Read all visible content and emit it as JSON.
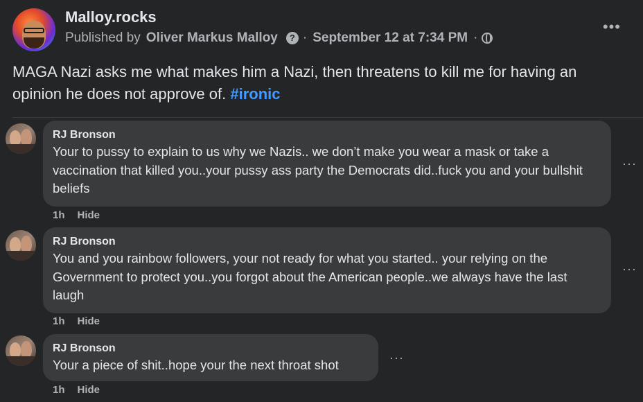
{
  "post": {
    "page_name": "Malloy.rocks",
    "published_by_prefix": "Published by",
    "author": "Oliver Markus Malloy",
    "date": "September 12 at 7:34 PM",
    "separator": "·",
    "text": "MAGA Nazi asks me what makes him a Nazi, then threatens to kill me for having an opinion he does not approve of.",
    "hashtag": "#ironic",
    "menu_icon": "more-horizontal-icon",
    "privacy_icon": "globe-icon"
  },
  "comments": [
    {
      "author": "RJ Bronson",
      "text": "Your to pussy to explain to us why we Nazis.. we don’t make you wear a mask or take a vaccination that killed you..your pussy ass party the Democrats did..fuck you and your bullshit beliefs",
      "time": "1h",
      "action": "Hide"
    },
    {
      "author": "RJ Bronson",
      "text": "You and you rainbow followers, your not ready for what you started.. your relying on the Government to protect you..you forgot about the American people..we always have the last laugh",
      "time": "1h",
      "action": "Hide"
    },
    {
      "author": "RJ Bronson",
      "text": "Your a piece of shit..hope your the next throat shot",
      "time": "1h",
      "action": "Hide"
    }
  ],
  "colors": {
    "background": "#242526",
    "bubble": "#3a3b3c",
    "text": "#e4e6eb",
    "secondary": "#b0b3b8",
    "hashtag": "#4599ff"
  }
}
